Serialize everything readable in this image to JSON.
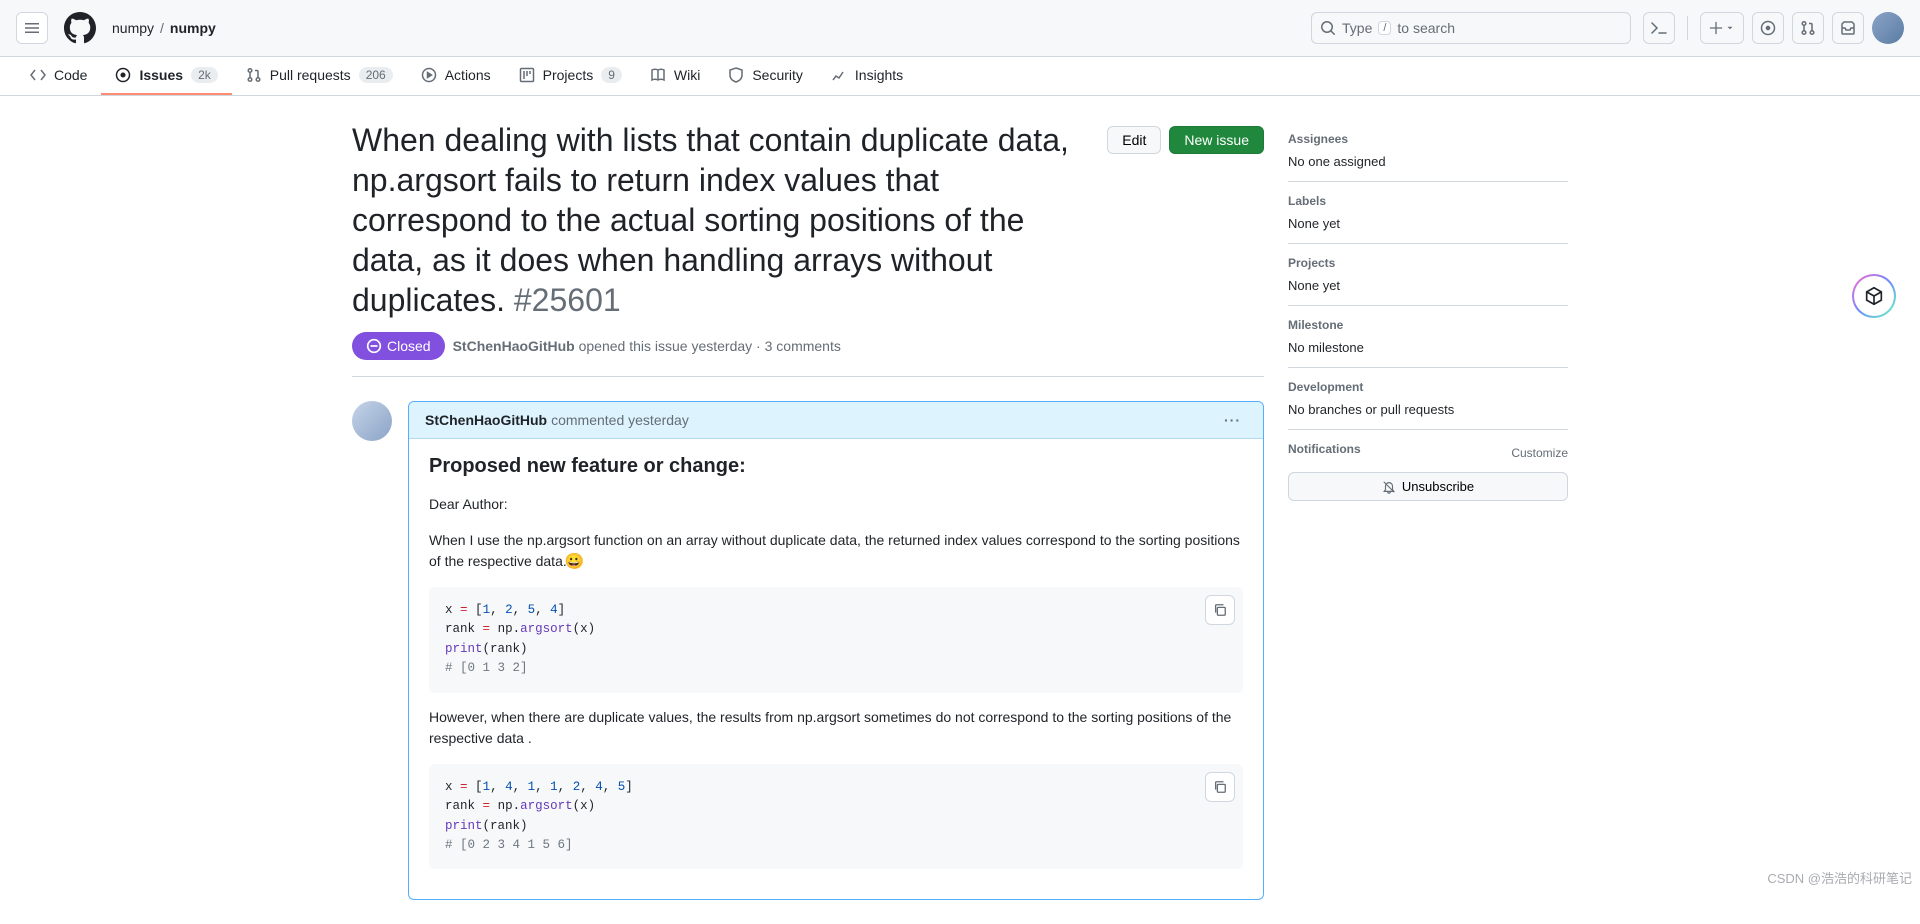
{
  "header": {
    "owner": "numpy",
    "repo": "numpy",
    "search_prefix": "Type",
    "search_key": "/",
    "search_suffix": "to search"
  },
  "nav": {
    "code": "Code",
    "issues": "Issues",
    "issues_count": "2k",
    "pulls": "Pull requests",
    "pulls_count": "206",
    "actions": "Actions",
    "projects": "Projects",
    "projects_count": "9",
    "wiki": "Wiki",
    "security": "Security",
    "insights": "Insights"
  },
  "issue": {
    "title": "When dealing with lists that contain duplicate data, np.argsort fails to return index values that correspond to the actual sorting positions of the data, as it does when handling arrays without duplicates.",
    "number": "#25601",
    "edit": "Edit",
    "new_issue": "New issue",
    "status": "Closed",
    "author": "StChenHaoGitHub",
    "opened_when": "opened this issue yesterday",
    "comment_count": "3 comments"
  },
  "comment": {
    "author": "StChenHaoGitHub",
    "when": "commented yesterday",
    "heading": "Proposed new feature or change:",
    "p1": "Dear Author:",
    "p2": "When I use the np.argsort function on an array without duplicate data, the returned index values correspond to the sorting positions of the respective data.",
    "code1": "x = [1, 2, 5, 4]\nrank = np.argsort(x)\nprint(rank)\n# [0 1 3 2]",
    "p3": "However, when there are duplicate values, the results from np.argsort sometimes do not correspond to the sorting positions of the respective data .",
    "code2": "x = [1, 4, 1, 1, 2, 4, 5]\nrank = np.argsort(x)\nprint(rank)\n# [0 2 3 4 1 5 6]"
  },
  "sidebar": {
    "assignees_h": "Assignees",
    "assignees_v": "No one assigned",
    "labels_h": "Labels",
    "labels_v": "None yet",
    "projects_h": "Projects",
    "projects_v": "None yet",
    "milestone_h": "Milestone",
    "milestone_v": "No milestone",
    "dev_h": "Development",
    "dev_v": "No branches or pull requests",
    "notif_h": "Notifications",
    "notif_cust": "Customize",
    "unsub": "Unsubscribe"
  },
  "watermark": "CSDN @浩浩的科研笔记"
}
